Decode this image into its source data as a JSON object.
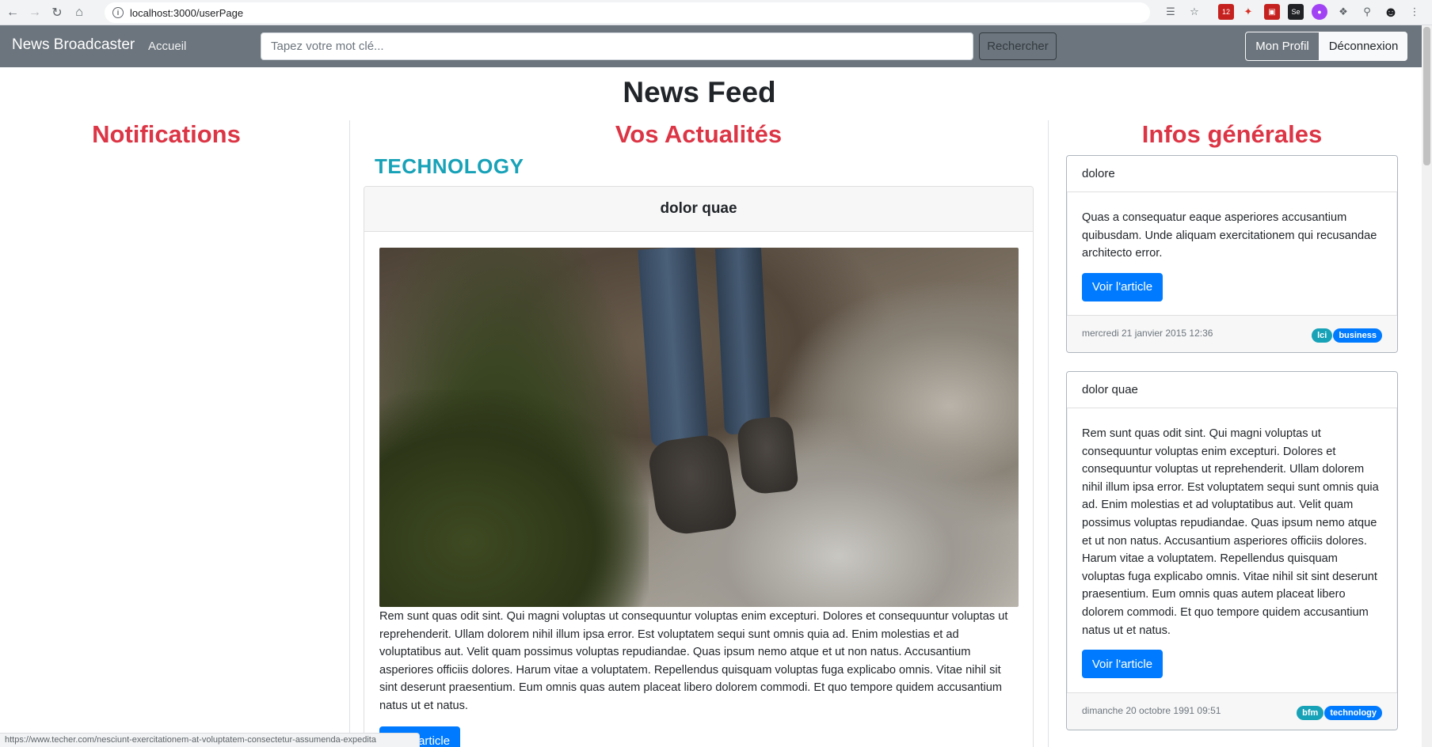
{
  "browser": {
    "url": "localhost:3000/userPage",
    "status_url": "https://www.techer.com/nesciunt-exercitationem-at-voluptatem-consectetur-assumenda-expedita"
  },
  "navbar": {
    "brand": "News Broadcaster",
    "home": "Accueil",
    "search_placeholder": "Tapez votre mot clé...",
    "search_button": "Rechercher",
    "profile_button": "Mon Profil",
    "logout_button": "Déconnexion"
  },
  "page": {
    "title": "News Feed"
  },
  "columns": {
    "left_title": "Notifications",
    "center_title": "Vos Actualités",
    "right_title": "Infos générales"
  },
  "feed": {
    "category": "TECHNOLOGY",
    "article": {
      "title": "dolor quae",
      "body": "Rem sunt quas odit sint. Qui magni voluptas ut consequuntur voluptas enim excepturi. Dolores et consequuntur voluptas ut reprehenderit. Ullam dolorem nihil illum ipsa error. Est voluptatem sequi sunt omnis quia ad. Enim molestias et ad voluptatibus aut. Velit quam possimus voluptas repudiandae. Quas ipsum nemo atque et ut non natus. Accusantium asperiores officiis dolores. Harum vitae a voluptatem. Repellendus quisquam voluptas fuga explicabo omnis. Vitae nihil sit sint deserunt praesentium. Eum omnis quas autem placeat libero dolorem commodi. Et quo tempore quidem accusantium natus ut et natus.",
      "button": "Voir l'article"
    }
  },
  "general": {
    "cards": [
      {
        "title": "dolore",
        "body": "Quas a consequatur eaque asperiores accusantium quibusdam. Unde aliquam exercitationem qui recusandae architecto error.",
        "button": "Voir l'article",
        "date": "mercredi 21 janvier 2015 12:36",
        "source": "lci",
        "category": "business"
      },
      {
        "title": "dolor quae",
        "body": "Rem sunt quas odit sint. Qui magni voluptas ut consequuntur voluptas enim excepturi. Dolores et consequuntur voluptas ut reprehenderit. Ullam dolorem nihil illum ipsa error. Est voluptatem sequi sunt omnis quia ad. Enim molestias et ad voluptatibus aut. Velit quam possimus voluptas repudiandae. Quas ipsum nemo atque et ut non natus. Accusantium asperiores officiis dolores. Harum vitae a voluptatem. Repellendus quisquam voluptas fuga explicabo omnis. Vitae nihil sit sint deserunt praesentium. Eum omnis quas autem placeat libero dolorem commodi. Et quo tempore quidem accusantium natus ut et natus.",
        "button": "Voir l'article",
        "date": "dimanche 20 octobre 1991 09:51",
        "source": "bfm",
        "category": "technology"
      }
    ]
  },
  "colors": {
    "navbar": "#6c757d",
    "heading_red": "#dc3545",
    "category_teal": "#17a2b8",
    "primary": "#007bff"
  },
  "icons": {
    "back": "back-arrow-icon",
    "forward": "forward-arrow-icon",
    "reload": "reload-icon",
    "home": "home-icon",
    "info": "info-icon",
    "translate": "translate-icon",
    "bookmark": "star-icon",
    "extensions": "puzzle-icon",
    "key": "key-icon",
    "account": "account-icon",
    "menu": "kebab-menu-icon"
  }
}
